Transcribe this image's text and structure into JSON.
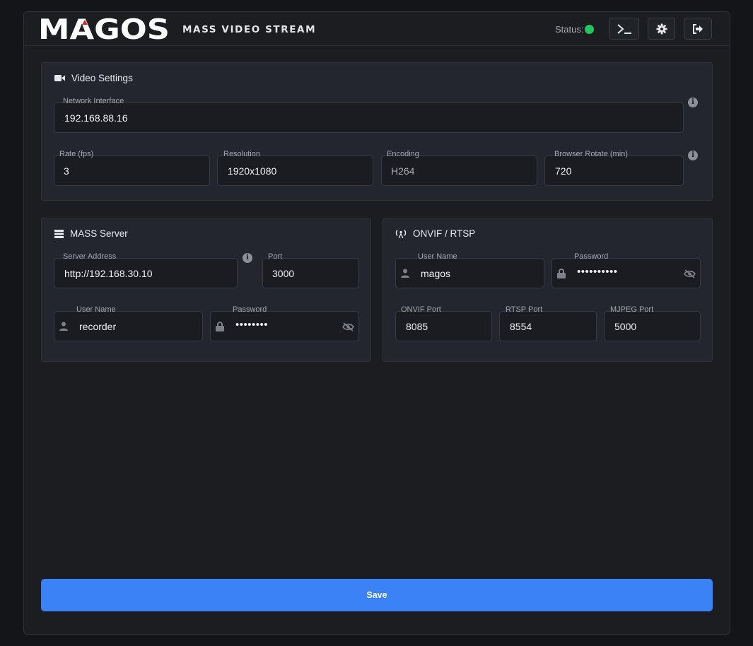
{
  "header": {
    "logo_text": "MAGOS",
    "subtitle": "MASS VIDEO STREAM",
    "status_label": "Status:",
    "status_color": "#22c55e",
    "buttons": [
      {
        "icon": "terminal-icon"
      },
      {
        "icon": "gear-icon"
      },
      {
        "icon": "logout-icon"
      }
    ]
  },
  "video_settings": {
    "title": "Video Settings",
    "network_interface": {
      "label": "Network Interface",
      "value": "192.168.88.16"
    },
    "rate": {
      "label": "Rate (fps)",
      "value": "3"
    },
    "resolution": {
      "label": "Resolution",
      "value": "1920x1080"
    },
    "encoding": {
      "label": "Encoding",
      "value": "H264"
    },
    "browser_rotate": {
      "label": "Browser Rotate (min)",
      "value": "720"
    }
  },
  "mass_server": {
    "title": "MASS Server",
    "server_address": {
      "label": "Server Address",
      "value": "http://192.168.30.10"
    },
    "port": {
      "label": "Port",
      "value": "3000"
    },
    "username": {
      "label": "User Name",
      "value": "recorder"
    },
    "password": {
      "label": "Password",
      "value": "••••••••"
    }
  },
  "onvif": {
    "title": "ONVIF / RTSP",
    "username": {
      "label": "User Name",
      "value": "magos"
    },
    "password": {
      "label": "Password",
      "value": "••••••••••"
    },
    "onvif_port": {
      "label": "ONVIF Port",
      "value": "8085"
    },
    "rtsp_port": {
      "label": "RTSP Port",
      "value": "8554"
    },
    "mjpeg_port": {
      "label": "MJPEG Port",
      "value": "5000"
    }
  },
  "save_label": "Save",
  "colors": {
    "accent": "#3b82f6",
    "logo_red": "#e0202a"
  }
}
